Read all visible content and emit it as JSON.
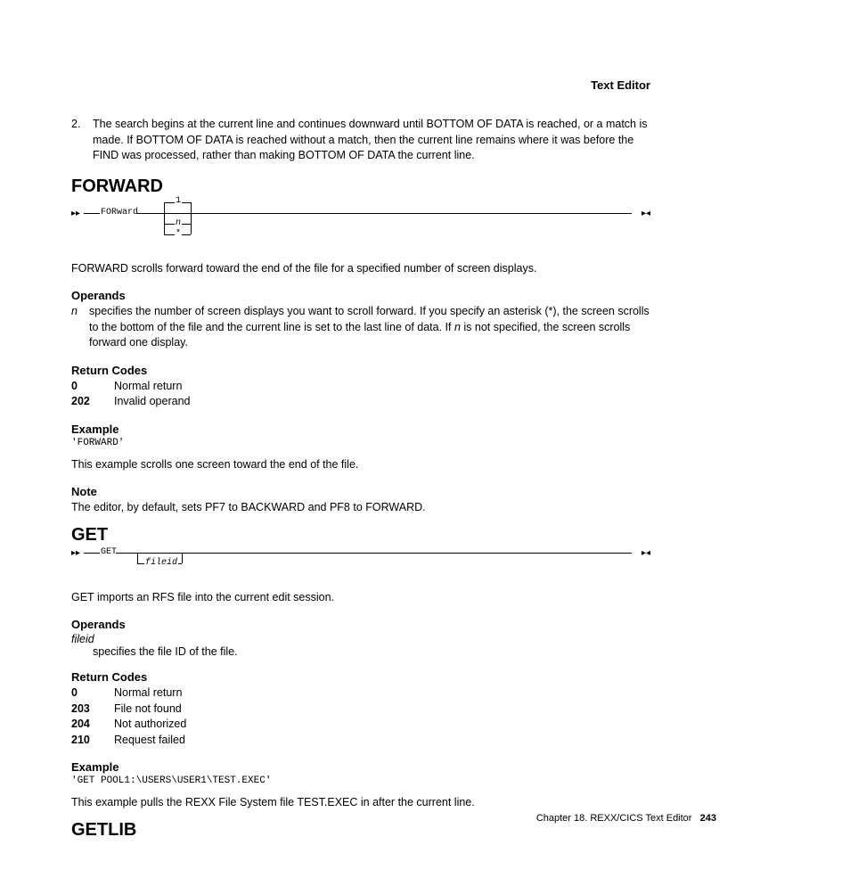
{
  "header": {
    "running": "Text Editor"
  },
  "note2": {
    "num": "2.",
    "text": "The search begins at the current line and continues downward until BOTTOM OF DATA is reached, or a match is made. If BOTTOM OF DATA is reached without a match, then the current line remains where it was before the FIND was processed, rather than making BOTTOM OF DATA the current line."
  },
  "forward": {
    "title": "FORWARD",
    "syntax_kw": "FORward",
    "syntax_default": "1",
    "syntax_alt1": "n",
    "syntax_alt2": "*",
    "desc": "FORWARD scrolls forward toward the end of the file for a specified number of screen displays.",
    "operands_h": "Operands",
    "op_term": "n",
    "op_def_a": "specifies the number of screen displays you want to scroll forward. If you specify an asterisk (*), the screen scrolls to the bottom of the file and the current line is set to the last line of data. If ",
    "op_def_em": "n",
    "op_def_b": " is not specified, the screen scrolls forward one display.",
    "rc_h": "Return Codes",
    "rc": [
      {
        "code": "0",
        "text": "Normal return"
      },
      {
        "code": "202",
        "text": "Invalid operand"
      }
    ],
    "ex_h": "Example",
    "ex_code": "'FORWARD'",
    "ex_desc": "This example scrolls one screen toward the end of the file.",
    "note_h": "Note",
    "note_text": "The editor, by default, sets PF7 to BACKWARD and PF8 to FORWARD."
  },
  "get": {
    "title": "GET",
    "syntax_kw": "GET",
    "syntax_arg": "fileid",
    "desc": "GET imports an RFS file into the current edit session.",
    "operands_h": "Operands",
    "op_term": "fileid",
    "op_def": "specifies the file ID of the file.",
    "rc_h": "Return Codes",
    "rc": [
      {
        "code": "0",
        "text": "Normal return"
      },
      {
        "code": "203",
        "text": "File not found"
      },
      {
        "code": "204",
        "text": "Not authorized"
      },
      {
        "code": "210",
        "text": "Request failed"
      }
    ],
    "ex_h": "Example",
    "ex_code": "'GET POOL1:\\USERS\\USER1\\TEST.EXEC'",
    "ex_desc": "This example pulls the REXX File System file TEST.EXEC in after the current line."
  },
  "getlib": {
    "title": "GETLIB"
  },
  "footer": {
    "chapter": "Chapter 18. REXX/CICS Text Editor",
    "page": "243"
  }
}
